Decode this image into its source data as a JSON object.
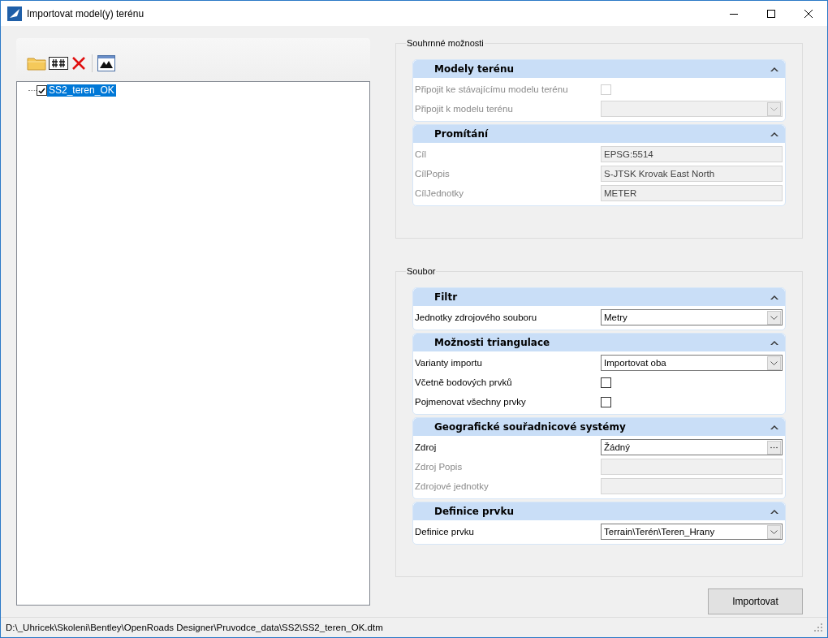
{
  "window": {
    "title": "Importovat model(y) terénu"
  },
  "tree": {
    "items": [
      {
        "label": "SS2_teren_OK",
        "checked": true,
        "selected": true
      }
    ]
  },
  "groups": [
    {
      "title": "Souhrnné možnosti",
      "sections": [
        {
          "title": "Modely terénu",
          "expanded": true,
          "rows": [
            {
              "kind": "checkbox",
              "label": "Připojit ke stávajícímu modelu terénu",
              "checked": false,
              "disabled": true
            },
            {
              "kind": "combo",
              "label": "Připojit k modelu terénu",
              "value": "",
              "disabled": true
            }
          ]
        },
        {
          "title": "Promítání",
          "expanded": true,
          "rows": [
            {
              "kind": "text",
              "label": "Cíl",
              "value": "EPSG:5514",
              "disabled": true
            },
            {
              "kind": "text",
              "label": "CílPopis",
              "value": "S-JTSK Krovak East North",
              "disabled": true
            },
            {
              "kind": "text",
              "label": "CílJednotky",
              "value": "METER",
              "disabled": true
            }
          ]
        }
      ]
    },
    {
      "title": "Soubor",
      "sections": [
        {
          "title": "Filtr",
          "expanded": true,
          "rows": [
            {
              "kind": "combo",
              "label": "Jednotky zdrojového souboru",
              "value": "Metry",
              "disabled": false
            }
          ]
        },
        {
          "title": "Možnosti triangulace",
          "expanded": true,
          "rows": [
            {
              "kind": "combo",
              "label": "Varianty importu",
              "value": "Importovat oba",
              "disabled": false
            },
            {
              "kind": "checkbox",
              "label": "Včetně bodových prvků",
              "checked": false,
              "disabled": false
            },
            {
              "kind": "checkbox",
              "label": "Pojmenovat všechny prvky",
              "checked": false,
              "disabled": false
            }
          ]
        },
        {
          "title": "Geografické souřadnicové systémy",
          "expanded": true,
          "rows": [
            {
              "kind": "browse",
              "label": "Zdroj",
              "value": "Žádný",
              "disabled": false
            },
            {
              "kind": "text",
              "label": "Zdroj Popis",
              "value": "",
              "disabled": true
            },
            {
              "kind": "text",
              "label": "Zdrojové jednotky",
              "value": "",
              "disabled": true
            }
          ]
        },
        {
          "title": "Definice prvku",
          "expanded": true,
          "rows": [
            {
              "kind": "combo",
              "label": "Definice prvku",
              "value": "Terrain\\Terén\\Teren_Hrany",
              "disabled": false
            }
          ]
        }
      ]
    }
  ],
  "import_button": "Importovat",
  "status_bar": {
    "path": "D:\\_Uhricek\\Skoleni\\Bentley\\OpenRoads Designer\\Pruvodce_data\\SS2\\SS2_teren_OK.dtm"
  }
}
